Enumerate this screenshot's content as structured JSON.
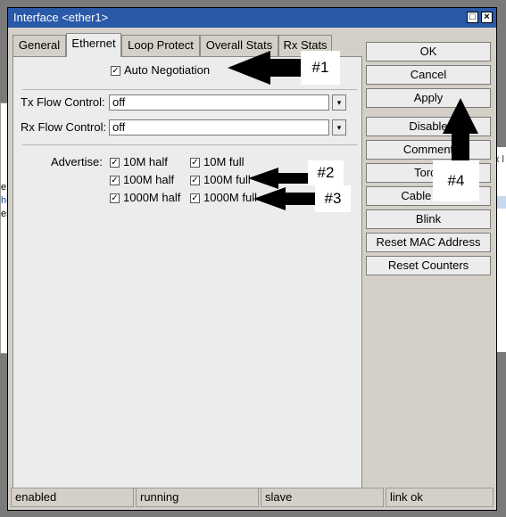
{
  "background": {
    "left_lines": [
      "e",
      "he",
      "es"
    ],
    "right_header": "x l"
  },
  "window": {
    "title": "Interface <ether1>",
    "max_icon": "maximize-icon",
    "close_icon": "close-icon"
  },
  "tabs": [
    {
      "label": "General",
      "active": false
    },
    {
      "label": "Ethernet",
      "active": true
    },
    {
      "label": "Loop Protect",
      "active": false
    },
    {
      "label": "Overall Stats",
      "active": false
    },
    {
      "label": "Rx Stats",
      "active": false
    }
  ],
  "ethernet": {
    "auto_negotiation": {
      "label": "Auto Negotiation",
      "checked": true
    },
    "tx_flow_control": {
      "label": "Tx Flow Control:",
      "value": "off"
    },
    "rx_flow_control": {
      "label": "Rx Flow Control:",
      "value": "off"
    },
    "advertise": {
      "label": "Advertise:",
      "options": [
        {
          "label": "10M half",
          "checked": true
        },
        {
          "label": "10M full",
          "checked": true
        },
        {
          "label": "100M half",
          "checked": true
        },
        {
          "label": "100M full",
          "checked": true
        },
        {
          "label": "1000M half",
          "checked": true
        },
        {
          "label": "1000M full",
          "checked": true
        }
      ]
    }
  },
  "buttons": [
    "OK",
    "Cancel",
    "Apply",
    "Disable",
    "Comment",
    "Torch",
    "Cable Test",
    "Blink",
    "Reset MAC Address",
    "Reset Counters"
  ],
  "status_bar": [
    "enabled",
    "running",
    "slave",
    "link ok"
  ],
  "annotations": [
    "#1",
    "#2",
    "#3",
    "#4"
  ],
  "check_glyph": "✓",
  "dropdown_glyph": "▾",
  "colors": {
    "titlebar": "#2a59a8",
    "dialog": "#d4d0c8",
    "panel": "#ececec"
  }
}
